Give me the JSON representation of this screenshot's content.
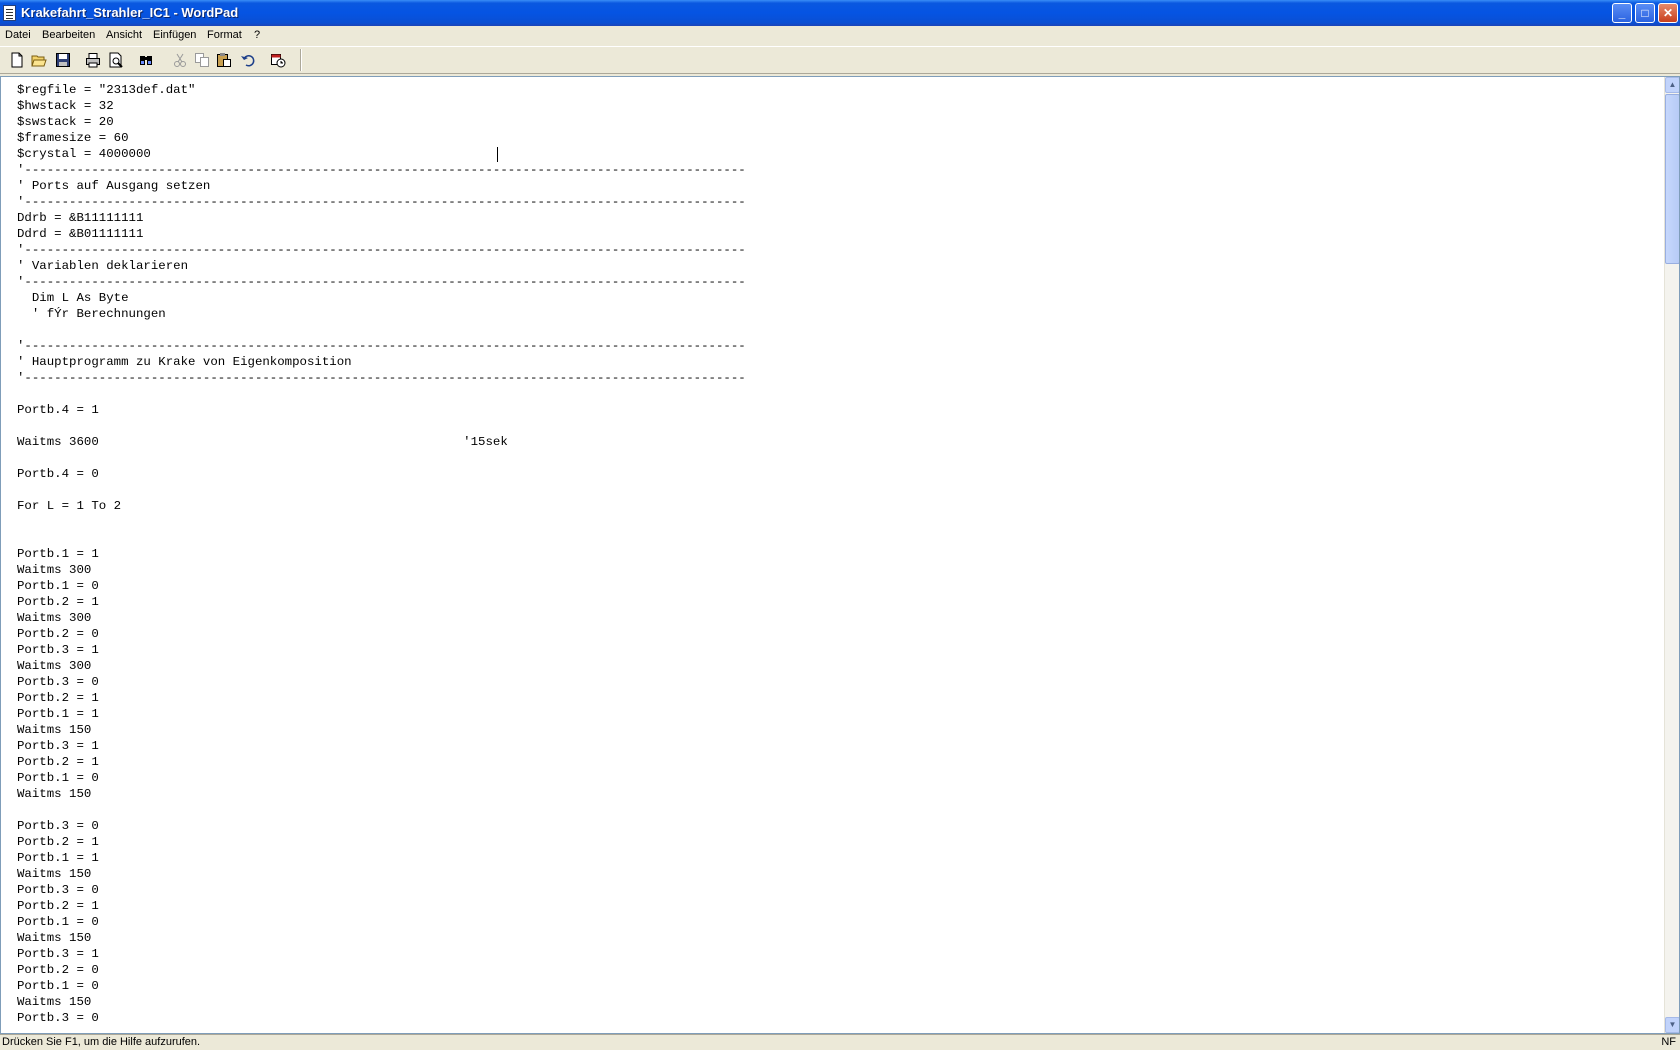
{
  "window": {
    "title": "Krakefahrt_Strahler_IC1 - WordPad",
    "buttons": {
      "minimize": "_",
      "maximize": "□",
      "close": "✕"
    }
  },
  "menu": [
    "Datei",
    "Bearbeiten",
    "Ansicht",
    "Einfügen",
    "Format",
    "?"
  ],
  "toolbar": [
    "new-document-icon",
    "open-folder-icon",
    "save-disk-icon",
    "print-icon",
    "print-preview-icon",
    "find-binoculars-icon",
    "cut-scissors-icon",
    "copy-icon",
    "paste-icon",
    "undo-icon",
    "insert-date-time-icon"
  ],
  "document": {
    "lines": [
      "$regfile = \"2313def.dat\"",
      "$hwstack = 32",
      "$swstack = 20",
      "$framesize = 60",
      "$crystal = 4000000",
      "'-------------------------------------------------------------------------------------------------",
      "' Ports auf Ausgang setzen",
      "'-------------------------------------------------------------------------------------------------",
      "Ddrb = &B11111111",
      "Ddrd = &B01111111",
      "'-------------------------------------------------------------------------------------------------",
      "' Variablen deklarieren",
      "'-------------------------------------------------------------------------------------------------",
      "  Dim L As Byte",
      "  ' fÝr Berechnungen",
      "",
      "'-------------------------------------------------------------------------------------------------",
      "' Hauptprogramm zu Krake von Eigenkomposition",
      "'-------------------------------------------------------------------------------------------------",
      "",
      "Portb.4 = 1",
      "",
      "Waitms 3600                                                 '15sek",
      "",
      "Portb.4 = 0",
      "",
      "For L = 1 To 2",
      "",
      "",
      "Portb.1 = 1",
      "Waitms 300",
      "Portb.1 = 0",
      "Portb.2 = 1",
      "Waitms 300",
      "Portb.2 = 0",
      "Portb.3 = 1",
      "Waitms 300",
      "Portb.3 = 0",
      "Portb.2 = 1",
      "Portb.1 = 1",
      "Waitms 150",
      "Portb.3 = 1",
      "Portb.2 = 1",
      "Portb.1 = 0",
      "Waitms 150",
      "",
      "Portb.3 = 0",
      "Portb.2 = 1",
      "Portb.1 = 1",
      "Waitms 150",
      "Portb.3 = 0",
      "Portb.2 = 1",
      "Portb.1 = 0",
      "Waitms 150",
      "Portb.3 = 1",
      "Portb.2 = 0",
      "Portb.1 = 0",
      "Waitms 150",
      "Portb.3 = 0"
    ]
  },
  "statusbar": {
    "help_text": "Drücken Sie F1, um die Hilfe aufzurufen.",
    "indicator": "NF"
  },
  "colors": {
    "titlebar_blue": "#0554e3",
    "window_face": "#ece9d8",
    "document_bg": "#ffffff"
  }
}
